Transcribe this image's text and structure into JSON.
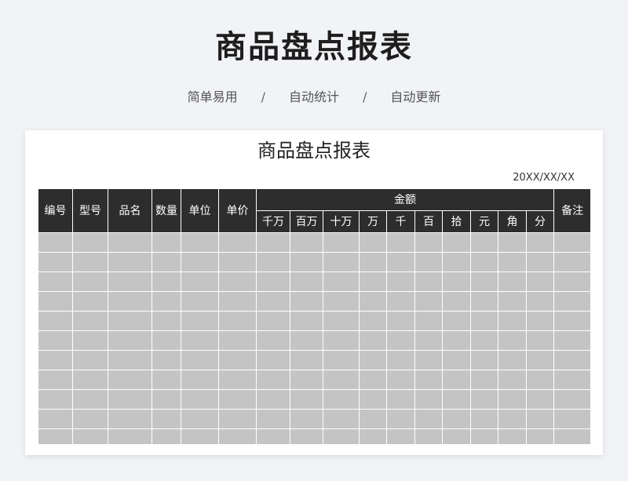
{
  "header": {
    "title": "商品盘点报表",
    "subtitle_items": [
      "简单易用",
      "自动统计",
      "自动更新"
    ],
    "separator": "/"
  },
  "document": {
    "title": "商品盘点报表",
    "date": "20XX/XX/XX",
    "columns": [
      "编号",
      "型号",
      "品名",
      "数量",
      "单位",
      "单价"
    ],
    "amount_group": "金额",
    "amount_digits": [
      "千万",
      "百万",
      "十万",
      "万",
      "千",
      "百",
      "拾",
      "元",
      "角",
      "分"
    ],
    "remark": "备注",
    "row_count": 11
  },
  "colors": {
    "background": "#f1f3f6",
    "header_fill": "#2d2d2d",
    "cell_fill": "#c4c4c4",
    "card": "#ffffff"
  }
}
